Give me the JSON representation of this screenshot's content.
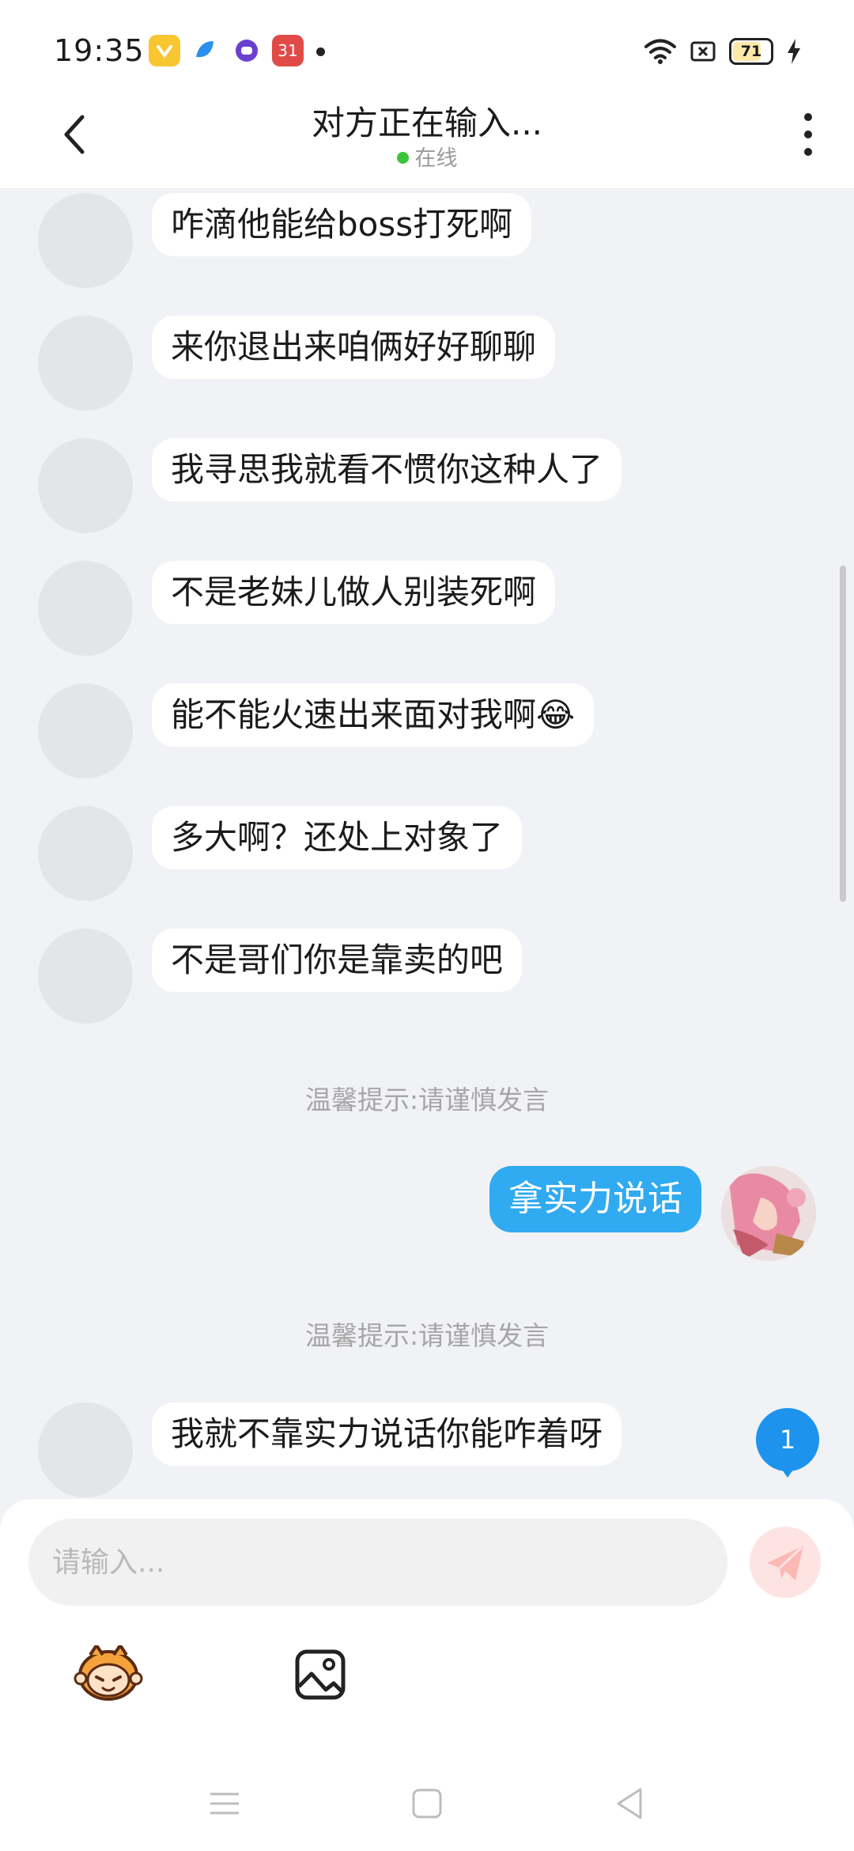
{
  "status_bar": {
    "time": "19:35",
    "notification_icons": [
      "yellow-heart-app-icon",
      "blue-app-icon",
      "purple-app-icon",
      "calendar-app-icon"
    ],
    "calendar_badge": "31",
    "battery_level": "71",
    "right_icons": [
      "wifi-icon",
      "sim-off-icon",
      "battery-icon",
      "charging-icon"
    ]
  },
  "header": {
    "title": "对方正在输入...",
    "status": "在线",
    "status_color": "#3cc53c"
  },
  "messages": [
    {
      "side": "left",
      "text": "咋滴他能给boss打死啊"
    },
    {
      "side": "left",
      "text": "来你退出来咱俩好好聊聊"
    },
    {
      "side": "left",
      "text": "我寻思我就看不惯你这种人了"
    },
    {
      "side": "left",
      "text": "不是老妹儿做人别装死啊"
    },
    {
      "side": "left",
      "text": "能不能火速出来面对我啊😂"
    },
    {
      "side": "left",
      "text": "多大啊？还处上对象了"
    },
    {
      "side": "left",
      "text": "不是哥们你是靠卖的吧"
    },
    {
      "type": "tip",
      "text": "温馨提示:请谨慎发言"
    },
    {
      "side": "right",
      "text": "拿实力说话"
    },
    {
      "type": "tip",
      "text": "温馨提示:请谨慎发言"
    },
    {
      "side": "left",
      "text": "我就不靠实力说话你能咋着呀"
    }
  ],
  "unread_badge": "1",
  "composer": {
    "placeholder": "请输入...",
    "send_icon": "paper-plane-icon",
    "emoji_icon": "emoji-mascot-icon",
    "image_icon": "image-icon"
  },
  "colors": {
    "accent": "#30aaf0",
    "badge": "#1d93ee",
    "background": "#f1f2f6"
  },
  "nav_bar": [
    "menu-icon",
    "home-icon",
    "back-triangle-icon"
  ]
}
